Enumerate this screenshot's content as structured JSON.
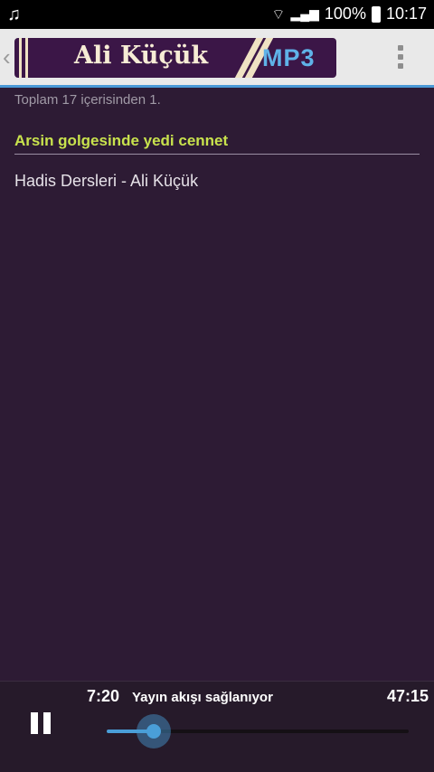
{
  "status_bar": {
    "notification_icon": "music-note-icon",
    "battery": "100%",
    "time": "10:17"
  },
  "app_bar": {
    "banner_title": "Ali Küçük",
    "banner_badge": "MP3"
  },
  "content": {
    "counter": "Toplam 17 içerisinden 1.",
    "section_title": "Arsin golgesinde yedi cennet",
    "track": "Hadis Dersleri - Ali Küçük"
  },
  "player": {
    "current_time": "7:20",
    "status": "Yayın akışı sağlanıyor",
    "total_time": "47:15",
    "progress": 0.155
  },
  "colors": {
    "accent": "#4a99d6",
    "title_green": "#c8e24d",
    "background": "#2d1b34"
  }
}
